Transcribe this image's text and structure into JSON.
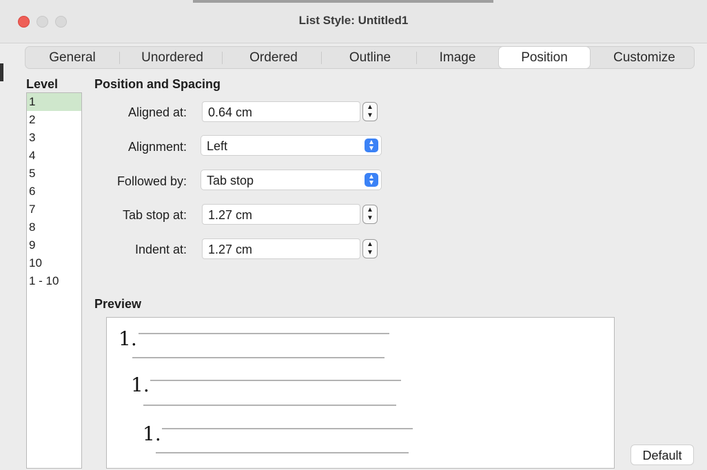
{
  "window": {
    "title": "List Style: Untitled1"
  },
  "tabs": [
    "General",
    "Unordered",
    "Ordered",
    "Outline",
    "Image",
    "Position",
    "Customize"
  ],
  "active_tab": "Position",
  "level": {
    "heading": "Level",
    "items": [
      "1",
      "2",
      "3",
      "4",
      "5",
      "6",
      "7",
      "8",
      "9",
      "10",
      "1 - 10"
    ],
    "selected": "1"
  },
  "position": {
    "heading": "Position and Spacing",
    "aligned_at": {
      "label": "Aligned at:",
      "value": "0.64 cm"
    },
    "alignment": {
      "label": "Alignment:",
      "value": "Left"
    },
    "followed_by": {
      "label": "Followed by:",
      "value": "Tab stop"
    },
    "tab_stop_at": {
      "label": "Tab stop at:",
      "value": "1.27 cm"
    },
    "indent_at": {
      "label": "Indent at:",
      "value": "1.27 cm"
    }
  },
  "preview": {
    "heading": "Preview",
    "numbers": [
      "1.",
      "1.",
      "1."
    ]
  },
  "buttons": {
    "default": "Default"
  },
  "colors": {
    "selected_level": "#cfe7cc",
    "select_button": "#3b82f6",
    "close": "#ee5f57"
  }
}
